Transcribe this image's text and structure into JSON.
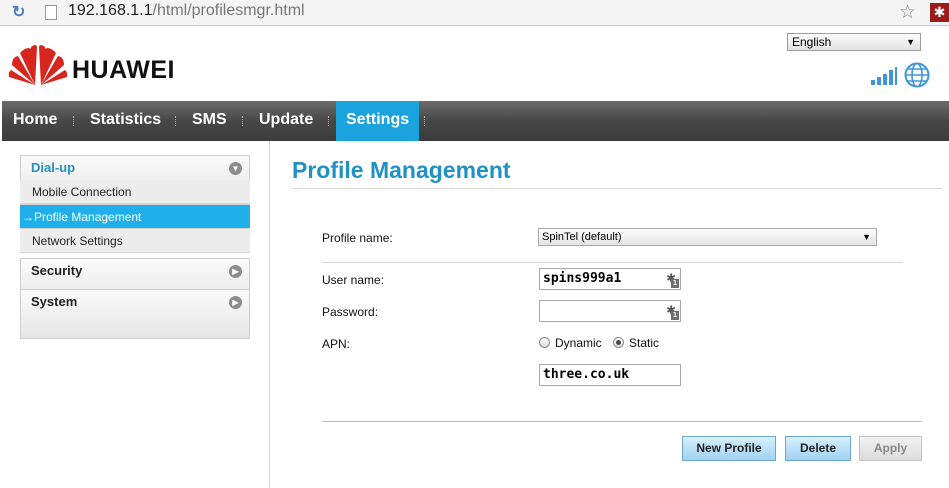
{
  "browser": {
    "url_host": "192.168.1.1",
    "url_path": "/html/profilesmgr.html"
  },
  "header": {
    "brand": "HUAWEI",
    "language": "English"
  },
  "nav": {
    "items": [
      {
        "label": "Home"
      },
      {
        "label": "Statistics"
      },
      {
        "label": "SMS"
      },
      {
        "label": "Update"
      },
      {
        "label": "Settings",
        "active": true
      }
    ]
  },
  "sidebar": {
    "groups": [
      {
        "label": "Dial-up",
        "items": [
          {
            "label": "Mobile Connection"
          },
          {
            "label": "→Profile Management",
            "active": true
          },
          {
            "label": "Network Settings"
          }
        ]
      },
      {
        "label": "Security"
      },
      {
        "label": "System"
      }
    ]
  },
  "main": {
    "title": "Profile Management",
    "profile_label": "Profile name:",
    "profile_value": "SpinTel (default)",
    "user_label": "User name:",
    "user_value": "spins999a1",
    "password_label": "Password:",
    "password_value": "",
    "apn_label": "APN:",
    "apn_options": [
      {
        "label": "Dynamic",
        "checked": false
      },
      {
        "label": "Static",
        "checked": true
      }
    ],
    "apn_value": "three.co.uk",
    "key_icon_badge": "1",
    "buttons": {
      "new_profile": "New Profile",
      "delete": "Delete",
      "apply": "Apply"
    }
  },
  "colors": {
    "accent": "#1aa3dc",
    "title": "#2191c4",
    "brand_red": "#d7261d"
  }
}
